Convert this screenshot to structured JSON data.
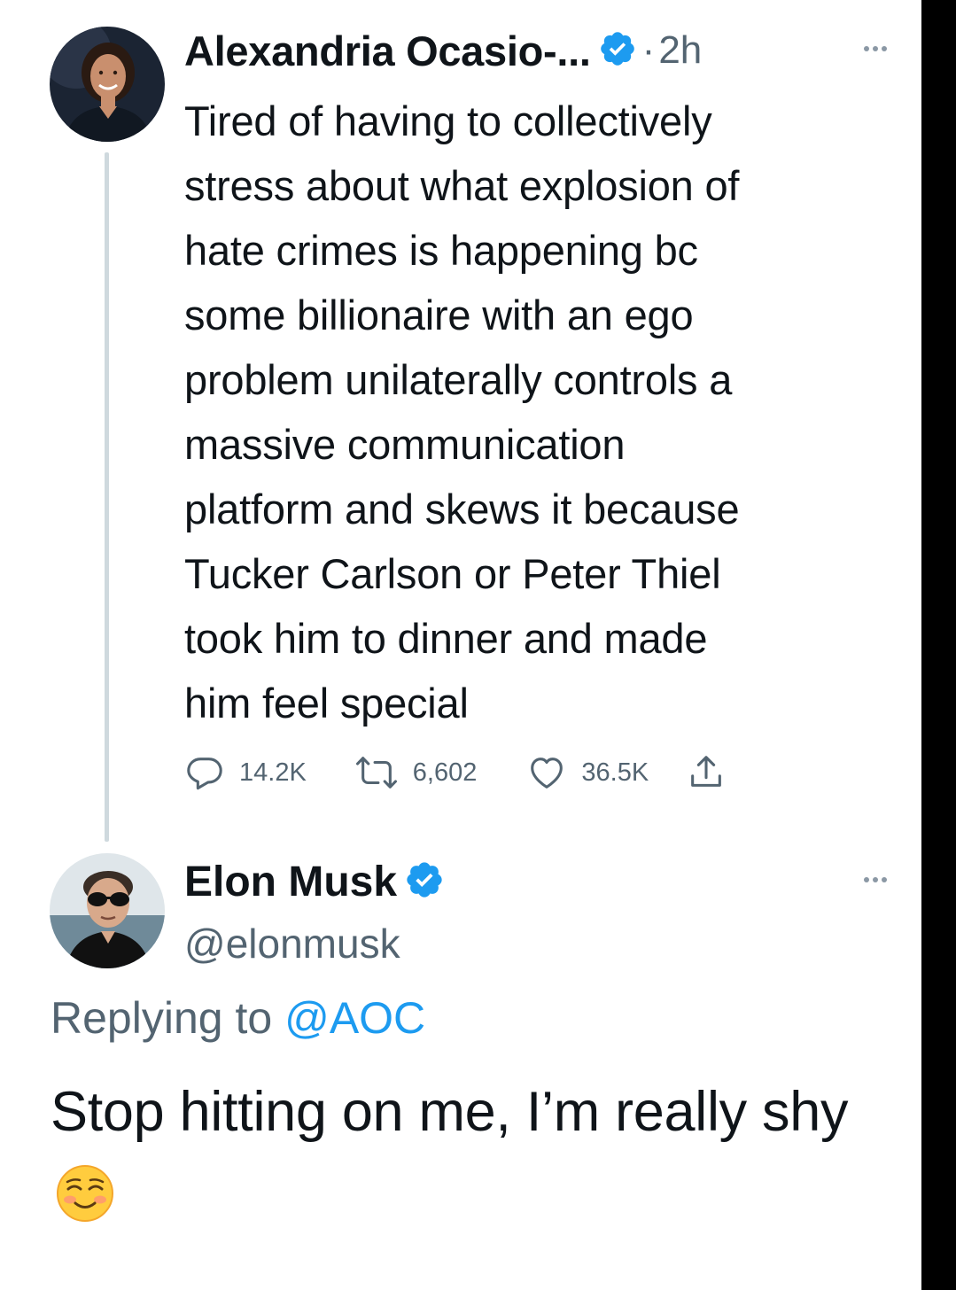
{
  "tweet1": {
    "author_name": "Alexandria Ocasio-...",
    "separator": "·",
    "time": "2h",
    "text": "Tired of having to collectively\nstress about what explosion of\nhate crimes is happening bc\nsome billionaire with an ego\nproblem unilaterally controls a\nmassive communication\nplatform and skews it because\nTucker Carlson or Peter Thiel\ntook him to dinner and made\nhim feel special",
    "replies": "14.2K",
    "retweets": "6,602",
    "likes": "36.5K",
    "icons": [
      "reply-icon",
      "retweet-icon",
      "like-icon",
      "share-icon",
      "verified-badge-icon",
      "more-icon"
    ]
  },
  "tweet2": {
    "author_name": "Elon Musk",
    "handle": "@elonmusk",
    "replying_prefix": "Replying to",
    "replying_to": "@AOC",
    "text": "Stop hitting on me, I’m really shy",
    "emoji": "smiling-face-emoji"
  },
  "colors": {
    "verified_blue": "#1d9bf0",
    "text_primary": "#0f1419",
    "text_secondary": "#536471",
    "thread_line": "#cfd9de",
    "background": "#ffffff",
    "outer_background": "#000000"
  }
}
